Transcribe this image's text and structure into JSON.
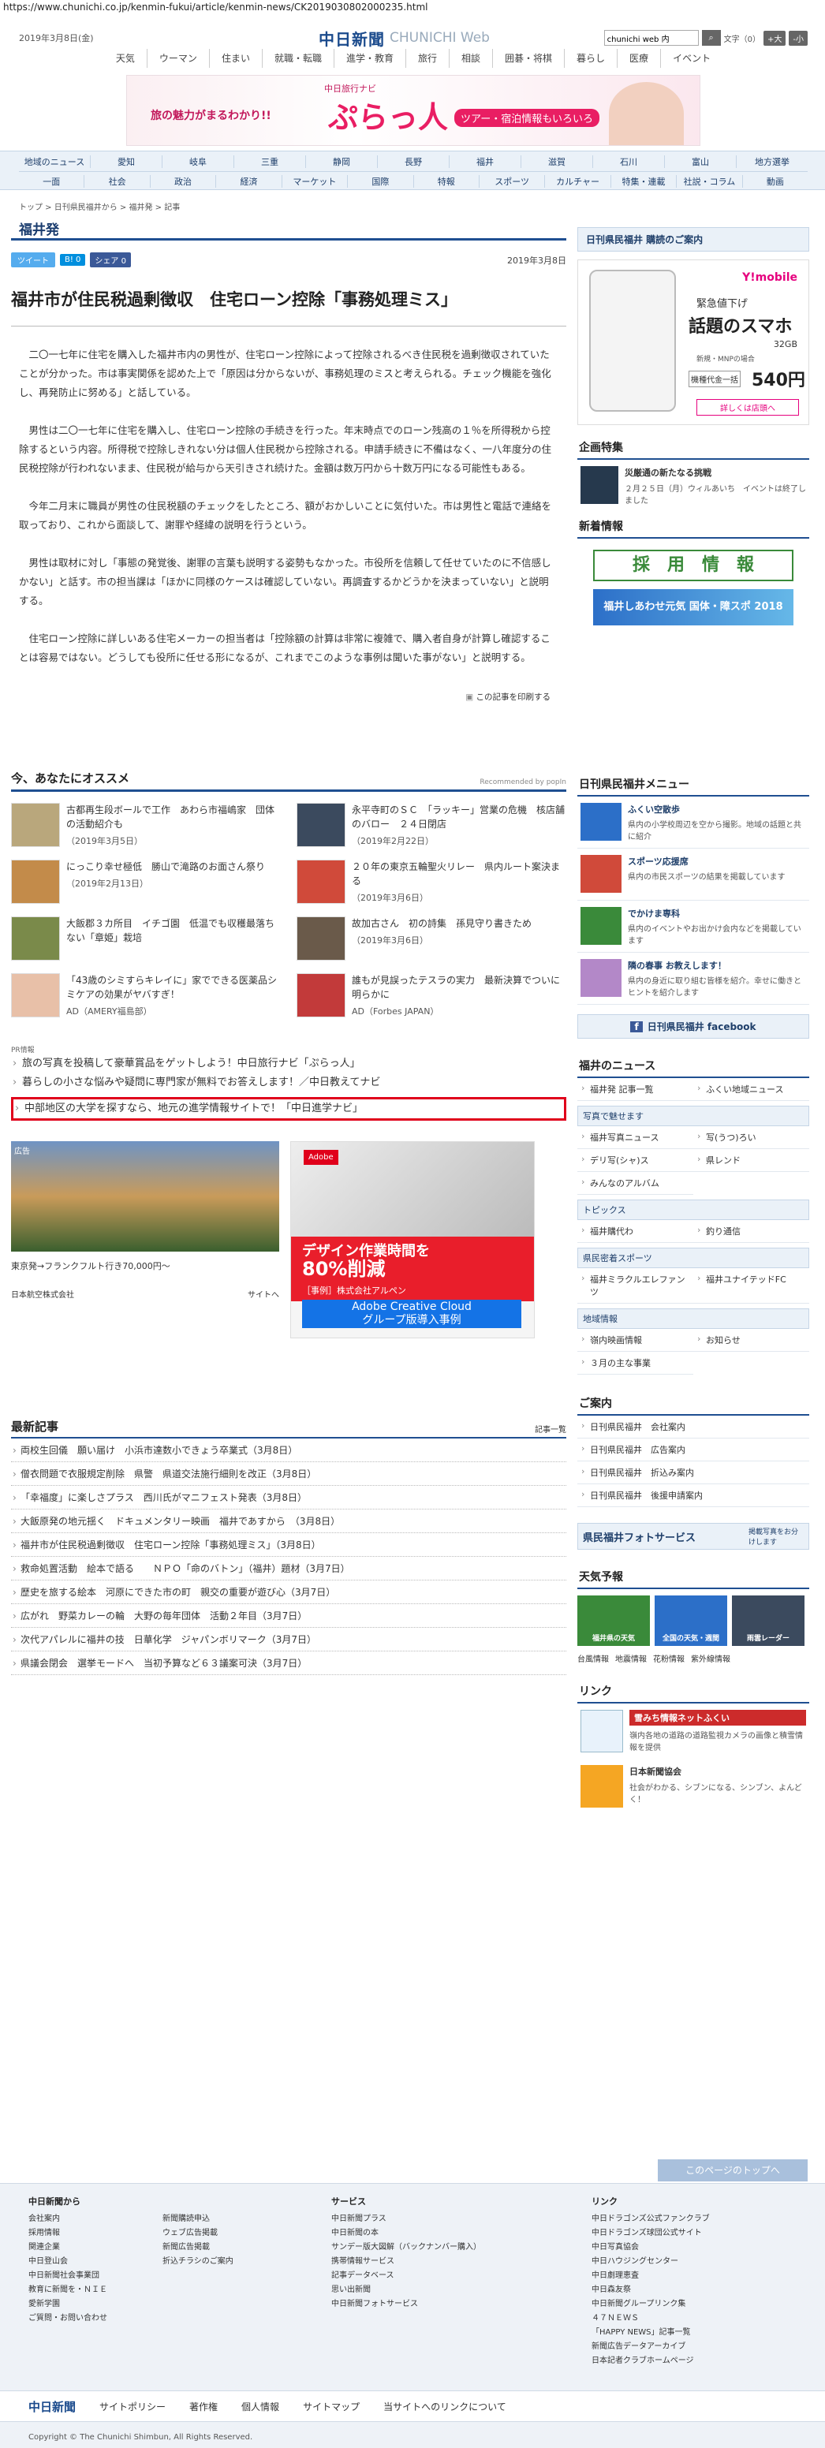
{
  "url": "https://www.chunichi.co.jp/kenmin-fukui/article/kenmin-news/CK2019030802000235.html",
  "header": {
    "date": "2019年3月8日(金)",
    "logo": "中日新聞",
    "logo_sub": "CHUNICHI Web",
    "search_value": "chunichi web 内",
    "fontsize_label": "文字（0）",
    "font_large": "+大",
    "font_small": "-小"
  },
  "gnav": [
    "天気",
    "ウーマン",
    "住まい",
    "就職・転職",
    "進学・教育",
    "旅行",
    "相談",
    "囲碁・将棋",
    "暮らし",
    "医療",
    "イベント"
  ],
  "banner": {
    "tag": "中日旅行ナビ",
    "lead": "旅の魅力がまるわかり!!",
    "title": "ぷらっ人",
    "cta": "ツアー・宿泊情報もいろいろ"
  },
  "regnav_row1": [
    "地域のニュース",
    "愛知",
    "岐阜",
    "三重",
    "静岡",
    "長野",
    "福井",
    "滋賀",
    "石川",
    "富山",
    "地方選挙"
  ],
  "regnav_row2": [
    "一面",
    "社会",
    "政治",
    "経済",
    "マーケット",
    "国際",
    "特報",
    "スポーツ",
    "カルチャー",
    "特集・連載",
    "社説・コラム",
    "動画"
  ],
  "breadcrumb": "トップ > 日刊県民福井から > 福井発 > 記事",
  "section_title": "福井発",
  "share": {
    "tweet": "ツイート",
    "hatena": "B! 0",
    "facebook": "シェア 0"
  },
  "article": {
    "date": "2019年3月8日",
    "headline": "福井市が住民税過剰徴収　住宅ローン控除「事務処理ミス」",
    "paragraphs": [
      "二〇一七年に住宅を購入した福井市内の男性が、住宅ローン控除によって控除されるべき住民税を過剰徴収されていたことが分かった。市は事実関係を認めた上で「原因は分からないが、事務処理のミスと考えられる。チェック機能を強化し、再発防止に努める」と話している。",
      "男性は二〇一七年に住宅を購入し、住宅ローン控除の手続きを行った。年末時点でのローン残高の１％を所得税から控除するという内容。所得税で控除しきれない分は個人住民税から控除される。申請手続きに不備はなく、一八年度分の住民税控除が行われないまま、住民税が給与から天引きされ続けた。金額は数万円から十数万円になる可能性もある。",
      "今年二月末に職員が男性の住民税額のチェックをしたところ、額がおかしいことに気付いた。市は男性と電話で連絡を取っており、これから面談して、謝罪や経緯の説明を行うという。",
      "男性は取材に対し「事態の発覚後、謝罪の言葉も説明する姿勢もなかった。市役所を信頼して任せていたのに不信感しかない」と話す。市の担当課は「ほかに同様のケースは確認していない。再調査するかどうかを決まっていない」と説明する。",
      "住宅ローン控除に詳しいある住宅メーカーの担当者は「控除額の計算は非常に複雑で、購入者自身が計算し確認することは容易ではない。どうしても役所に任せる形になるが、これまでこのような事例は聞いた事がない」と説明する。"
    ],
    "print_label": "この記事を印刷する"
  },
  "recommend": {
    "title": "今、あなたにオススメ",
    "powered": "Recommended by popIn",
    "items": [
      {
        "title": "古都再生段ボールで工作　あわら市福嶋家　団体の活動紹介も",
        "date": "（2019年3月5日）"
      },
      {
        "title": "永平寺町のＳＣ　「ラッキー」営業の危機　核店舗のバロー　２４日閉店",
        "date": "（2019年2月22日）"
      },
      {
        "title": "にっこり幸せ極低　勝山で滝路のお面さん祭り",
        "date": "（2019年2月13日）"
      },
      {
        "title": "２０年の東京五輪聖火リレー　県内ルート案決まる",
        "date": "（2019年3月6日）"
      },
      {
        "title": "大飯郡３カ所目　イチゴ園　低温でも収穫最落ちない「章姫」栽培",
        "date": ""
      },
      {
        "title": "故加古さん　初の詩集　孫見守り書きため",
        "date": "（2019年3月6日）"
      },
      {
        "title": "「43歳のシミすらキレイに」家でできる医薬品シミケアの効果がヤバすぎ！",
        "date": "AD（AMERY福島部）"
      },
      {
        "title": "誰もが見誤ったテスラの実力　最新決算でついに明らかに",
        "date": "AD（Forbes JAPAN）"
      }
    ]
  },
  "pr": {
    "label": "PR情報",
    "links": [
      "旅の写真を投稿して豪華賞品をゲットしよう！中日旅行ナビ「ぷらっ人」",
      "暮らしの小さな悩みや疑問に専門家が無料でお答えします！／中日教えてナビ",
      "中部地区の大学を探すなら、地元の進学情報サイトで！「中日進学ナビ」"
    ]
  },
  "ads": {
    "ad_label": "広告",
    "jal_caption": "東京発→フランクフルト行き70,000円〜",
    "jal_name": "日本航空株式会社",
    "jal_site": "サイトへ",
    "adobe_brand": "Adobe",
    "adobe_big1": "デザイン作業時間を",
    "adobe_big2": "80%削減",
    "adobe_case": "［事例］株式会社アルペン",
    "adobe_btn1": "Adobe Creative Cloud",
    "adobe_btn2": "グループ版導入事例"
  },
  "latest": {
    "title": "最新記事",
    "more": "記事一覧",
    "items": [
      "両校生回儀　願い届け　小浜市達数小できょう卒業式（3月8日）",
      "僧衣問題で衣服規定削除　県警　県道交法施行細則を改正（3月8日）",
      "「幸福度」に楽しさプラス　西川氏がマニフェスト発表（3月8日）",
      "大飯原発の地元揺く　ドキュメンタリー映画　福井であすから　（3月8日）",
      "福井市が住民税過剰徴収　住宅ローン控除「事務処理ミス」（3月8日）",
      "救命処置活動　絵本で語る　　ＮＰＯ「命のバトン」（福井）題材（3月7日）",
      "歴史を旅する絵本　河原にできた市の町　親交の重要が遊び心（3月7日）",
      "広がれ　野菜カレーの輪　大野の毎年団体　活動２年目（3月7日）",
      "次代アパレルに福井の技　日華化学　ジャパンボリマーク（3月7日）",
      "県議会閉会　選挙モードへ　当初予算など６３議案可決（3月7日）"
    ]
  },
  "sidebar": {
    "subscribe": "日刊県民福井 購読のご案内",
    "ymobile": {
      "brand": "Y!mobile",
      "sale": "緊急値下げ",
      "title": "話題のスマホ",
      "capacity": "32GB",
      "model": "新規・MNPの場合",
      "price_label": "機種代金一括",
      "price": "540円",
      "more": "詳しくは店頭へ"
    },
    "kikaku_title": "企画特集",
    "kikaku_item_title": "災厳通の新たなる挑戦",
    "kikaku_item_text": "２月２５日（月）ウィルあいち　イベントは終了しました",
    "newsinfo_title": "新着情報",
    "recruit": "採　用　情　報",
    "kokutai": "福井しあわせ元気 国体・障スポ 2018",
    "menu_title": "日刊県民福井メニュー",
    "menu": [
      {
        "title": "ふくい空散歩",
        "text": "県内の小学校周辺を空から撮影。地域の話題と共に紹介"
      },
      {
        "title": "スポーツ応援席",
        "text": "県内の市民スポーツの結果を掲載しています"
      },
      {
        "title": "でかけま専科",
        "text": "県内のイベントやお出かけ会内などを掲載しています"
      },
      {
        "title": "隣の春事 お教えします！",
        "text": "県内の身近に取り組む皆様を紹介。幸せに働きとヒントを紹介します"
      }
    ],
    "facebook": "日刊県民福井 facebook",
    "news_title": "福井のニュース",
    "news_links": [
      "福井発 記事一覧",
      "ふくい地域ニュース"
    ],
    "photo_title": "写真で魅せます",
    "photo_links": [
      "福井写真ニュース",
      "写(うつ)ろい",
      "デリ写(シャ)ス",
      "県レンド",
      "みんなのアルバム"
    ],
    "topics_title": "トピックス",
    "topics_links": [
      "福井購代わ",
      "釣り通信"
    ],
    "sports_title": "県民密着スポーツ",
    "sports_links": [
      "福井ミラクルエレファンツ",
      "福井ユナイテッドFC"
    ],
    "local_title": "地域情報",
    "local_links": [
      "嶺内映画情報",
      "お知らせ",
      "３月の主な事業"
    ],
    "guide_title": "ご案内",
    "guide_links": [
      "日刊県民福井　会社案内",
      "日刊県民福井　広告案内",
      "日刊県民福井　折込み案内",
      "日刊県民福井　後援申請案内"
    ],
    "photo_service": "県民福井フォトサービス",
    "photo_service_sub": "掲載写真をお分けします",
    "weather_title": "天気予報",
    "weather_cards": [
      "福井県の天気",
      "全国の天気・週間",
      "雨雲レーダー"
    ],
    "weather_links": [
      "台風情報",
      "地震情報",
      "花粉情報",
      "紫外線情報"
    ],
    "link_title": "リンク",
    "link1_title": "雪みち情報ネットふくい",
    "link1_text": "嶺内各地の道路の道路監視カメラの画像と積雪情報を提供",
    "link2_title": "日本新聞協会",
    "link2_text": "社会がわかる、シブンになる、シンブン、よんどく！"
  },
  "totop": "このページのトップへ",
  "footer": {
    "col1_title": "中日新聞から",
    "col1": [
      "会社案内",
      "採用情報",
      "関連企業",
      "中日登山会",
      "中日新聞社会事業団",
      "教育に新聞を・ＮＩＥ",
      "愛新学園",
      "ご質問・お問い合わせ"
    ],
    "col2": [
      "新聞購読申込",
      "ウェブ広告掲載",
      "新聞広告掲載",
      "折込チラシのご案内"
    ],
    "col3_title": "サービス",
    "col3": [
      "中日新聞プラス",
      "中日新聞の本",
      "サンデー版大図解（バックナンバー購入）",
      "携帯情報サービス",
      "記事データベース",
      "思い出新聞",
      "中日新聞フォトサービス"
    ],
    "col4_title": "リンク",
    "col4": [
      "中日ドラゴンズ公式ファンクラブ",
      "中日ドラゴンズ球団公式サイト",
      "中日写真協会",
      "中日ハウジングセンター",
      "中日劇理恵査",
      "中日森友祭",
      "中日新聞グループリンク集",
      "４７ＮＥＷＳ",
      "「HAPPY NEWS」記事一覧",
      "新聞広告データアーカイブ",
      "日本記者クラブホームページ"
    ],
    "bar_logo": "中日新聞",
    "bar_links": [
      "サイトポリシー",
      "著作権",
      "個人情報",
      "サイトマップ",
      "当サイトへのリンクについて"
    ],
    "copyright": "Copyright © The Chunichi Shimbun, All Rights Reserved."
  },
  "colors": {
    "brand": "#1a4a8c",
    "accent_rule": "#1f4f91",
    "pr_highlight": "#e0001b"
  }
}
